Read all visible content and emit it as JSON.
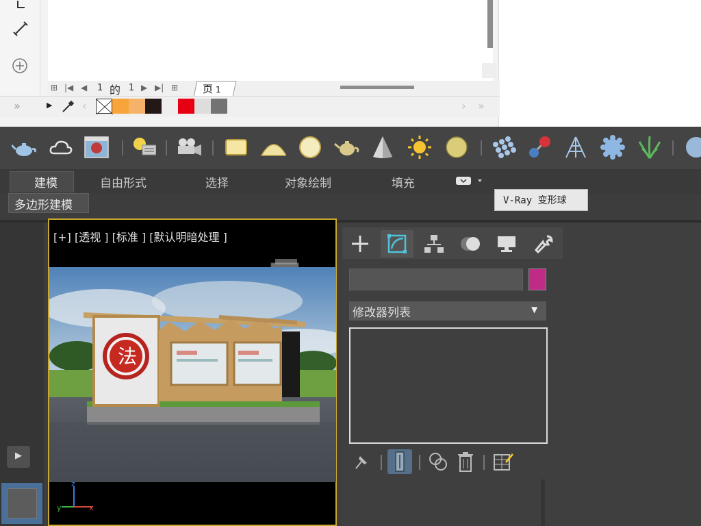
{
  "doc": {
    "pager": {
      "current_page": "1",
      "of_label": "的",
      "total_pages": "1",
      "page_tab_label": "页",
      "page_tab_num": "1"
    },
    "palette": [
      "#f7a53a",
      "#f5b36a",
      "#231815",
      "#eeeeee",
      "#e60012",
      "#dddddd",
      "#737373"
    ]
  },
  "toolbar": {
    "icons": [
      "teapot-icon",
      "cloud-icon",
      "render-frame-icon",
      "light-lister-icon",
      "camera-icon",
      "plane-light-icon",
      "dome-light-icon",
      "sphere-light-icon",
      "teapot-light-icon",
      "cone-icon",
      "sun-icon",
      "ies-light-icon",
      "grid-spheres-icon",
      "molecule-icon",
      "tripod-icon",
      "blob-icon",
      "grass-icon",
      "sphere-icon"
    ]
  },
  "ribbon": {
    "tabs": [
      "建模",
      "自由形式",
      "选择",
      "对象绘制",
      "填充"
    ],
    "active_tab": "建模",
    "subtab": "多边形建模",
    "tooltip": "V-Ray 变形球"
  },
  "viewport": {
    "label": "[+] [透视 ] [标准 ] [默认明暗处理 ]",
    "sign_char": "法",
    "axis_x": "x",
    "axis_y": "y",
    "axis_z": "z"
  },
  "command_panel": {
    "tabs": [
      "create-tab",
      "modify-tab",
      "hierarchy-tab",
      "motion-tab",
      "display-tab",
      "utilities-tab"
    ],
    "name_value": "",
    "object_color": "#c02b86",
    "modifier_list_label": "修改器列表"
  },
  "colors": {
    "accent_yellow": "#c8a830",
    "cyan_active": "#4fc3d9",
    "bg_dark": "#3d3d3d"
  }
}
